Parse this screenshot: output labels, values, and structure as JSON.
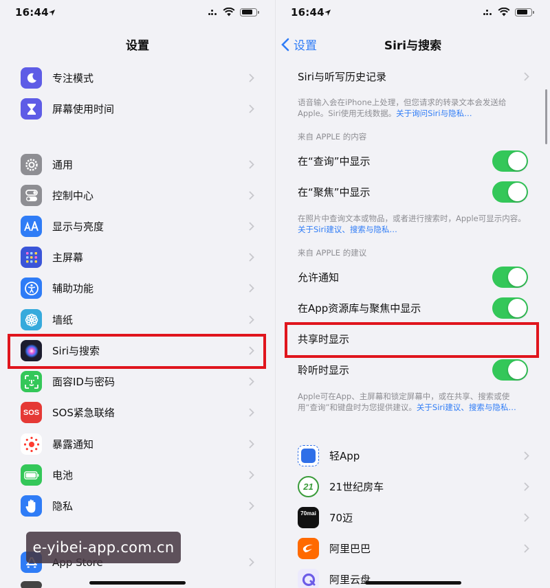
{
  "status": {
    "time": "16:44"
  },
  "left": {
    "title": "设置",
    "items": [
      {
        "label": "专注模式",
        "icon": "moon-icon",
        "color": "#5e5ce6"
      },
      {
        "label": "屏幕使用时间",
        "icon": "hourglass-icon",
        "color": "#5e5ce6"
      },
      {
        "label": "通用",
        "icon": "gear-icon",
        "color": "#8e8e93"
      },
      {
        "label": "控制中心",
        "icon": "toggles-icon",
        "color": "#8e8e93"
      },
      {
        "label": "显示与亮度",
        "icon": "text-size-icon",
        "color": "#2f7cf6"
      },
      {
        "label": "主屏幕",
        "icon": "grid-icon",
        "color": "#3a55d8"
      },
      {
        "label": "辅助功能",
        "icon": "accessibility-icon",
        "color": "#2f7cf6"
      },
      {
        "label": "墙纸",
        "icon": "flower-icon",
        "color": "#36aadc"
      },
      {
        "label": "Siri与搜索",
        "icon": "siri-icon",
        "color": "#1c1c2e"
      },
      {
        "label": "面容ID与密码",
        "icon": "face-id-icon",
        "color": "#34c759"
      },
      {
        "label": "SOS紧急联络",
        "icon": "sos-icon",
        "color": "#e53935",
        "icon_text": "SOS"
      },
      {
        "label": "暴露通知",
        "icon": "exposure-icon",
        "color": "#ffffff"
      },
      {
        "label": "电池",
        "icon": "battery-icon",
        "color": "#34c759"
      },
      {
        "label": "隐私",
        "icon": "hand-icon",
        "color": "#2f7cf6"
      },
      {
        "label": "App Store",
        "icon": "app-store-icon",
        "color": "#2f7cf6"
      }
    ]
  },
  "right": {
    "back_label": "设置",
    "title": "Siri与搜索",
    "history_label": "Siri与听写历史记录",
    "footer1_text": "语音输入会在iPhone上处理，但您请求的转录文本会发送给Apple。Siri使用无线数据。",
    "footer1_link": "关于询问Siri与隐私…",
    "section1": "来自 APPLE 的内容",
    "show_in_lookup": "在“查询”中显示",
    "show_in_spotlight": "在“聚焦”中显示",
    "footer2_text": "在照片中查询文本或物品，或者进行搜索时，Apple可显示内容。",
    "footer2_link": "关于Siri建议、搜索与隐私…",
    "section2": "来自 APPLE 的建议",
    "allow_notifications": "允许通知",
    "show_in_library": "在App资源库与聚焦中显示",
    "show_when_sharing": "共享时显示",
    "show_when_listening": "聆听时显示",
    "footer3_text": "Apple可在App、主屏幕和锁定屏幕中，或在共享、搜索或使用“查询”和键盘时为您提供建议。",
    "footer3_link": "关于Siri建议、搜索与隐私…",
    "apps": [
      {
        "label": "轻App",
        "icon": "light-app-icon",
        "color": "#2f6fe8"
      },
      {
        "label": "21世纪房车",
        "icon": "rv-21-icon",
        "color": "#3a9b3a",
        "icon_text": "21"
      },
      {
        "label": "70迈",
        "icon": "70mai-icon",
        "color": "#111111",
        "icon_text": "70mai"
      },
      {
        "label": "阿里巴巴",
        "icon": "alibaba-icon",
        "color": "#ff6a00"
      },
      {
        "label": "阿里云盘",
        "icon": "aliyun-drive-icon",
        "color": "#6c5ce7"
      }
    ]
  },
  "watermark": "e-yibei-app.com.cn"
}
